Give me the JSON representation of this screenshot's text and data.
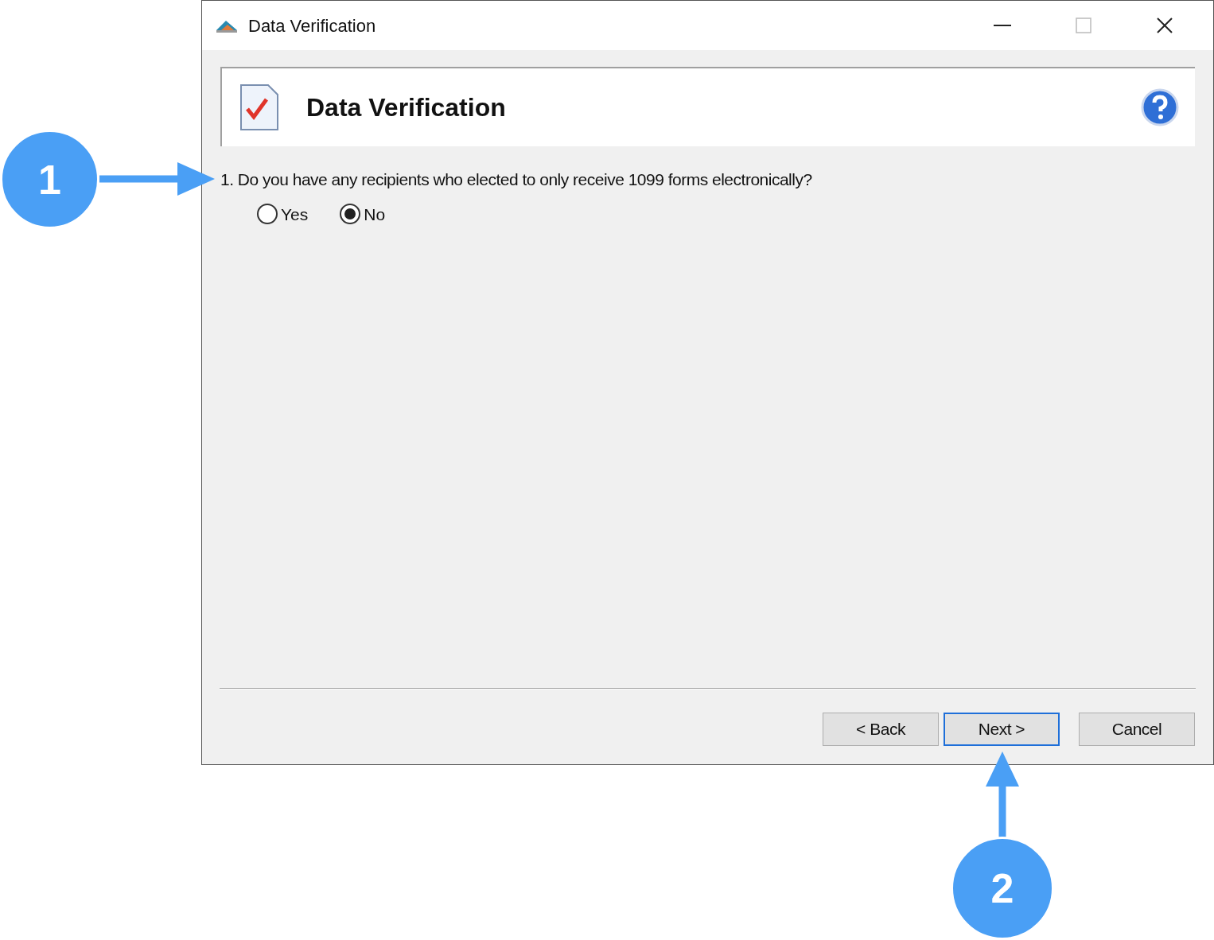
{
  "window": {
    "title": "Data Verification"
  },
  "header": {
    "title": "Data Verification"
  },
  "question": {
    "text": "1. Do you have any recipients who elected to only receive 1099 forms electronically?",
    "options": [
      {
        "label": "Yes",
        "selected": false
      },
      {
        "label": "No",
        "selected": true
      }
    ]
  },
  "buttons": [
    {
      "label": "< Back",
      "default": false
    },
    {
      "label": "Next >",
      "default": true
    },
    {
      "label": "Cancel",
      "default": false
    }
  ],
  "callouts": [
    {
      "label": "1"
    },
    {
      "label": "2"
    }
  ]
}
